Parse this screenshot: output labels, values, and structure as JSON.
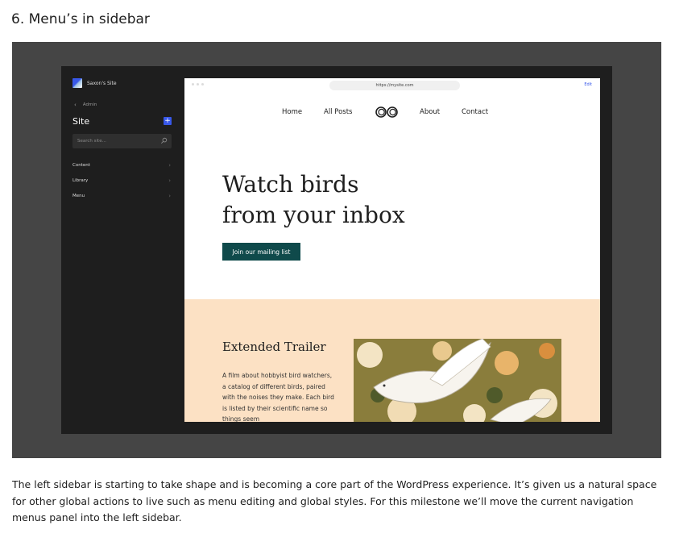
{
  "heading": "6. Menu’s in sidebar",
  "sidebar": {
    "site_name": "Saxon's Site",
    "back_label": "Admin",
    "title": "Site",
    "add_label": "+",
    "search_placeholder": "Search site...",
    "items": [
      {
        "label": "Content"
      },
      {
        "label": "Library"
      },
      {
        "label": "Menu"
      }
    ]
  },
  "browser": {
    "url": "https://mysite.com",
    "edit_label": "Edit"
  },
  "site": {
    "nav": [
      "Home",
      "All Posts",
      "About",
      "Contact"
    ],
    "hero_line1": "Watch birds",
    "hero_line2": "from your inbox",
    "cta_label": "Join our mailing list",
    "section_title": "Extended Trailer",
    "section_body": "A film about hobbyist bird watchers, a catalog of different birds, paired with the noises they make. Each bird is listed by their scientific name so things seem"
  },
  "paragraph": "The left sidebar is starting to take shape and is becoming a core part of the WordPress experience. It’s given us a natural space for other global actions to live such as menu editing and global styles. For this milestone we’ll move the current navigation menus panel into the left sidebar.",
  "colors": {
    "frame": "#454545",
    "app_bg": "#1e1e1e",
    "accent": "#3858e9",
    "cta": "#0f4a4b",
    "peach": "#fce1c4"
  },
  "icons": [
    "site-logo-icon",
    "chevron-left-icon",
    "plus-icon",
    "search-icon",
    "chevron-right-icon",
    "binoculars-logo-icon"
  ]
}
